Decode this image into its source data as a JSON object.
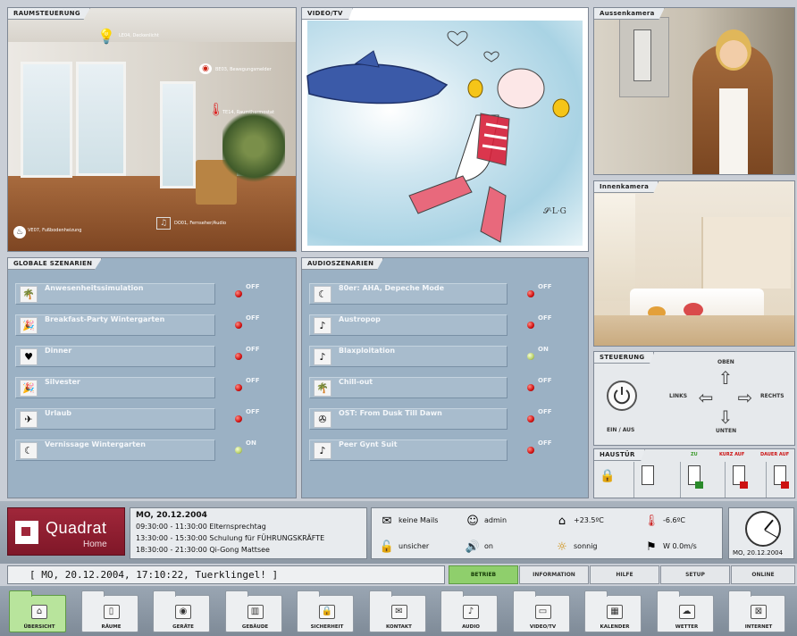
{
  "panels": {
    "room": "RAUMSTEUERUNG",
    "video": "VIDEO/TV",
    "cam_outside": "Aussenkamera",
    "cam_inside": "Innenkamera",
    "global": "GLOBALE SZENARIEN",
    "audio": "AUDIOSZENARIEN",
    "control": "STEUERUNG",
    "door": "HAUSTÜR"
  },
  "room_labels": [
    "LE04, Deckenlicht",
    "BE03, Bewegungsmelder",
    "TE14, Raumthermostat",
    "VE07, Fußbodenheizung",
    "DO01, Fernseher/Audio"
  ],
  "global_scenarios": [
    {
      "label": "Anwesenheitssimulation",
      "state": "OFF",
      "icon": "palm-icon",
      "glyph": "🌴"
    },
    {
      "label": "Breakfast-Party Wintergarten",
      "state": "OFF",
      "icon": "party-icon",
      "glyph": "🎉"
    },
    {
      "label": "Dinner",
      "state": "OFF",
      "icon": "heart-icon",
      "glyph": "♥"
    },
    {
      "label": "Silvester",
      "state": "OFF",
      "icon": "party-icon",
      "glyph": "🎉"
    },
    {
      "label": "Urlaub",
      "state": "OFF",
      "icon": "plane-icon",
      "glyph": "✈"
    },
    {
      "label": "Vernissage Wintergarten",
      "state": "ON",
      "icon": "moon-icon",
      "glyph": "☾"
    }
  ],
  "audio_scenarios": [
    {
      "label": "80er: AHA, Depeche Mode",
      "state": "OFF",
      "icon": "moon-icon",
      "glyph": "☾"
    },
    {
      "label": "Austropop",
      "state": "OFF",
      "icon": "music-note-icon",
      "glyph": "♪"
    },
    {
      "label": "Blaxploitation",
      "state": "ON",
      "icon": "music-note-icon",
      "glyph": "♪"
    },
    {
      "label": "Chill-out",
      "state": "OFF",
      "icon": "palm-icon",
      "glyph": "🌴"
    },
    {
      "label": "OST: From Dusk Till Dawn",
      "state": "OFF",
      "icon": "film-icon",
      "glyph": "✇"
    },
    {
      "label": "Peer Gynt Suit",
      "state": "OFF",
      "icon": "music-note-icon",
      "glyph": "♪"
    }
  ],
  "control": {
    "up": "OBEN",
    "down": "UNTEN",
    "left": "LINKS",
    "right": "RECHTS",
    "power": "EIN / AUS"
  },
  "door": {
    "zu": "ZU",
    "kurz_auf": "KURZ AUF",
    "dauer_auf": "DAUER AUF"
  },
  "logo": {
    "name": "Quadrat",
    "sub": "Home"
  },
  "calendar": {
    "date": "MO, 20.12.2004",
    "entries": [
      "09:30:00 - 11:30:00  Elternsprechtag",
      "13:30:00 - 15:30:00  Schulung für FÜHRUNGSKRÄFTE",
      "18:30:00 - 21:30:00  Qi-Gong Mattsee"
    ]
  },
  "info": {
    "mails": "keine Mails",
    "user": "admin",
    "temp_in": "+23.5ºC",
    "temp_out": "-6.6ºC",
    "security": "unsicher",
    "audio": "on",
    "weather": "sonnig",
    "wind": "W 0.0m/s"
  },
  "clock": {
    "date": "MO, 20.12.2004"
  },
  "message": "[ MO, 20.12.2004, 17:10:22, Tuerklingel! ]",
  "modes": [
    "BETRIEB",
    "INFORMATION",
    "HILFE",
    "SETUP",
    "ONLINE"
  ],
  "nav": [
    {
      "label": "ÜBERSICHT",
      "glyph": "⌂"
    },
    {
      "label": "RÄUME",
      "glyph": "▯"
    },
    {
      "label": "GERÄTE",
      "glyph": "◉"
    },
    {
      "label": "GEBÄUDE",
      "glyph": "▥"
    },
    {
      "label": "SICHERHEIT",
      "glyph": "🔒"
    },
    {
      "label": "KONTAKT",
      "glyph": "✉"
    },
    {
      "label": "AUDIO",
      "glyph": "♪"
    },
    {
      "label": "VIDEO/TV",
      "glyph": "▭"
    },
    {
      "label": "KALENDER",
      "glyph": "▦"
    },
    {
      "label": "WETTER",
      "glyph": "☁"
    },
    {
      "label": "INTERNET",
      "glyph": "⊠"
    }
  ]
}
